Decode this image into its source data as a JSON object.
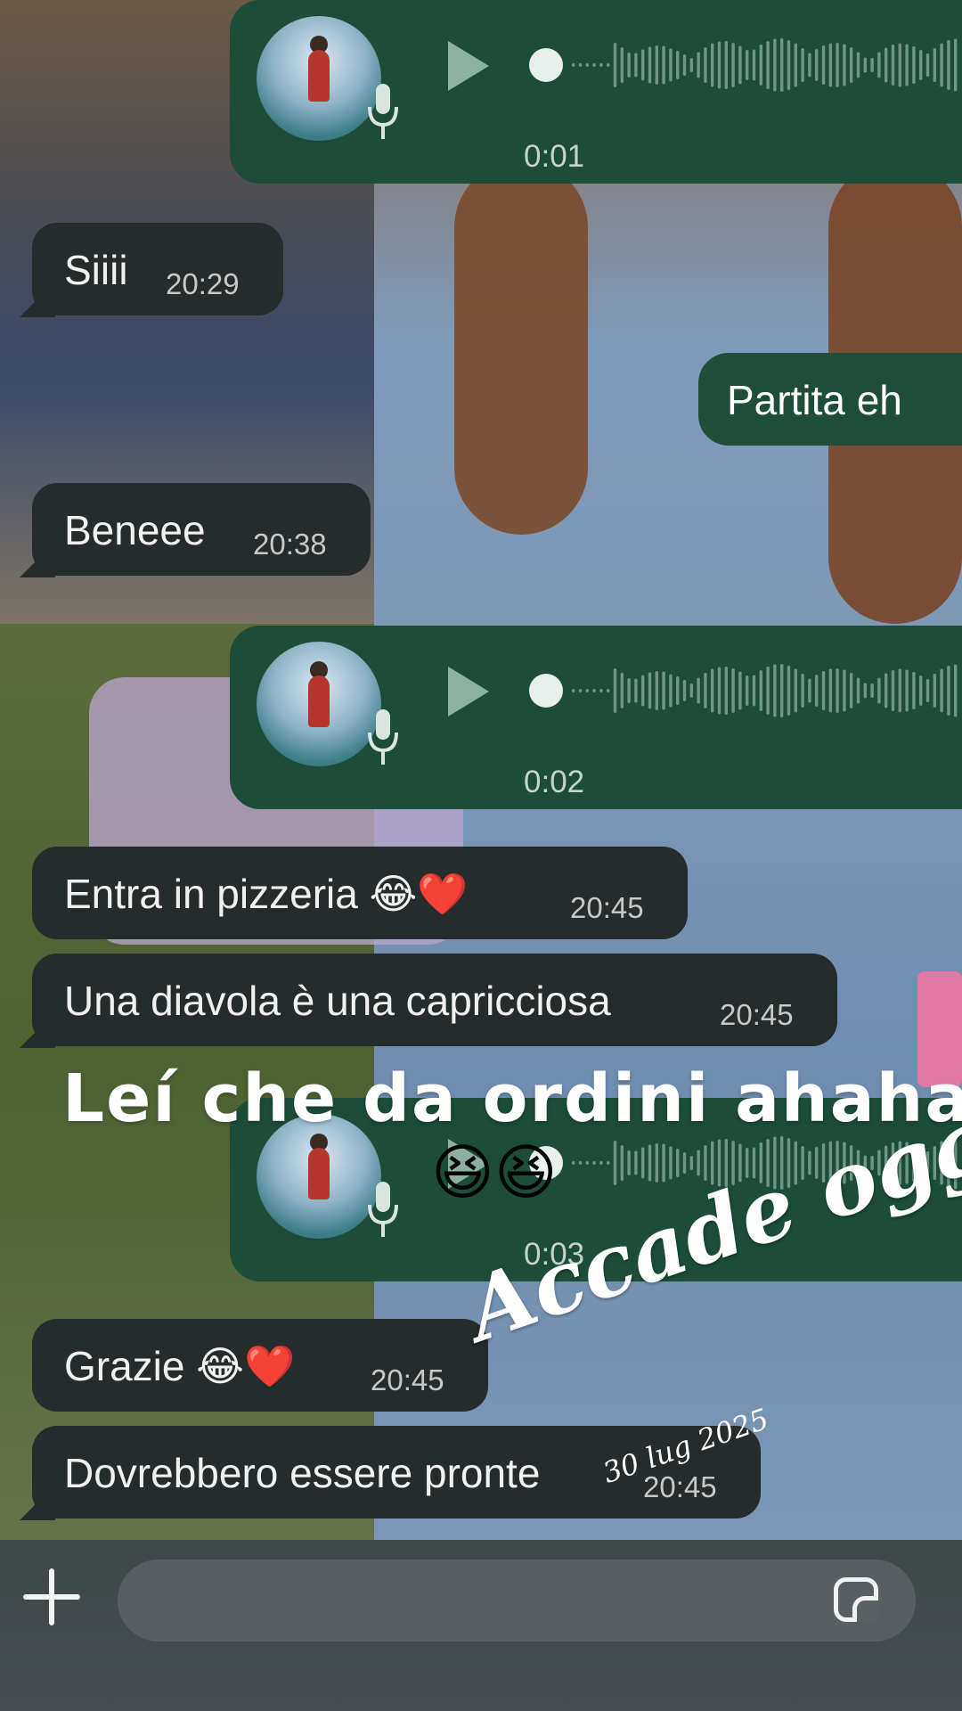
{
  "messages": [
    {
      "type": "voice",
      "direction": "out",
      "duration": "0:01"
    },
    {
      "type": "text",
      "direction": "in",
      "text": "Siiii",
      "time": "20:29"
    },
    {
      "type": "text",
      "direction": "out",
      "text": "Partita eh"
    },
    {
      "type": "text",
      "direction": "in",
      "text": "Beneee",
      "time": "20:38"
    },
    {
      "type": "voice",
      "direction": "out",
      "duration": "0:02"
    },
    {
      "type": "text",
      "direction": "in",
      "text": "Entra in pizzeria 😂❤️",
      "time": "20:45"
    },
    {
      "type": "text",
      "direction": "in",
      "text": "Una diavola è una capricciosa",
      "time": "20:45"
    },
    {
      "type": "voice",
      "direction": "out",
      "duration": "0:03"
    },
    {
      "type": "text",
      "direction": "in",
      "text": "Grazie 😂❤️",
      "time": "20:45"
    },
    {
      "type": "text",
      "direction": "in",
      "text": "Dovrebbero essere pronte",
      "time": "20:45"
    }
  ],
  "overlay": {
    "caption": "Leí che da ordini ahaha",
    "caption_emoji": "😆😆",
    "sticker_title": "Accade oggi",
    "sticker_date": "30 lug 2025"
  },
  "composer": {
    "add_icon": "plus-icon",
    "sticker_icon": "sticker-icon"
  },
  "colors": {
    "incoming_bubble": "#262b2b",
    "outgoing_bubble": "#1b4d38",
    "text": "#f1f1f1",
    "timestamp": "#c7c9c9"
  }
}
